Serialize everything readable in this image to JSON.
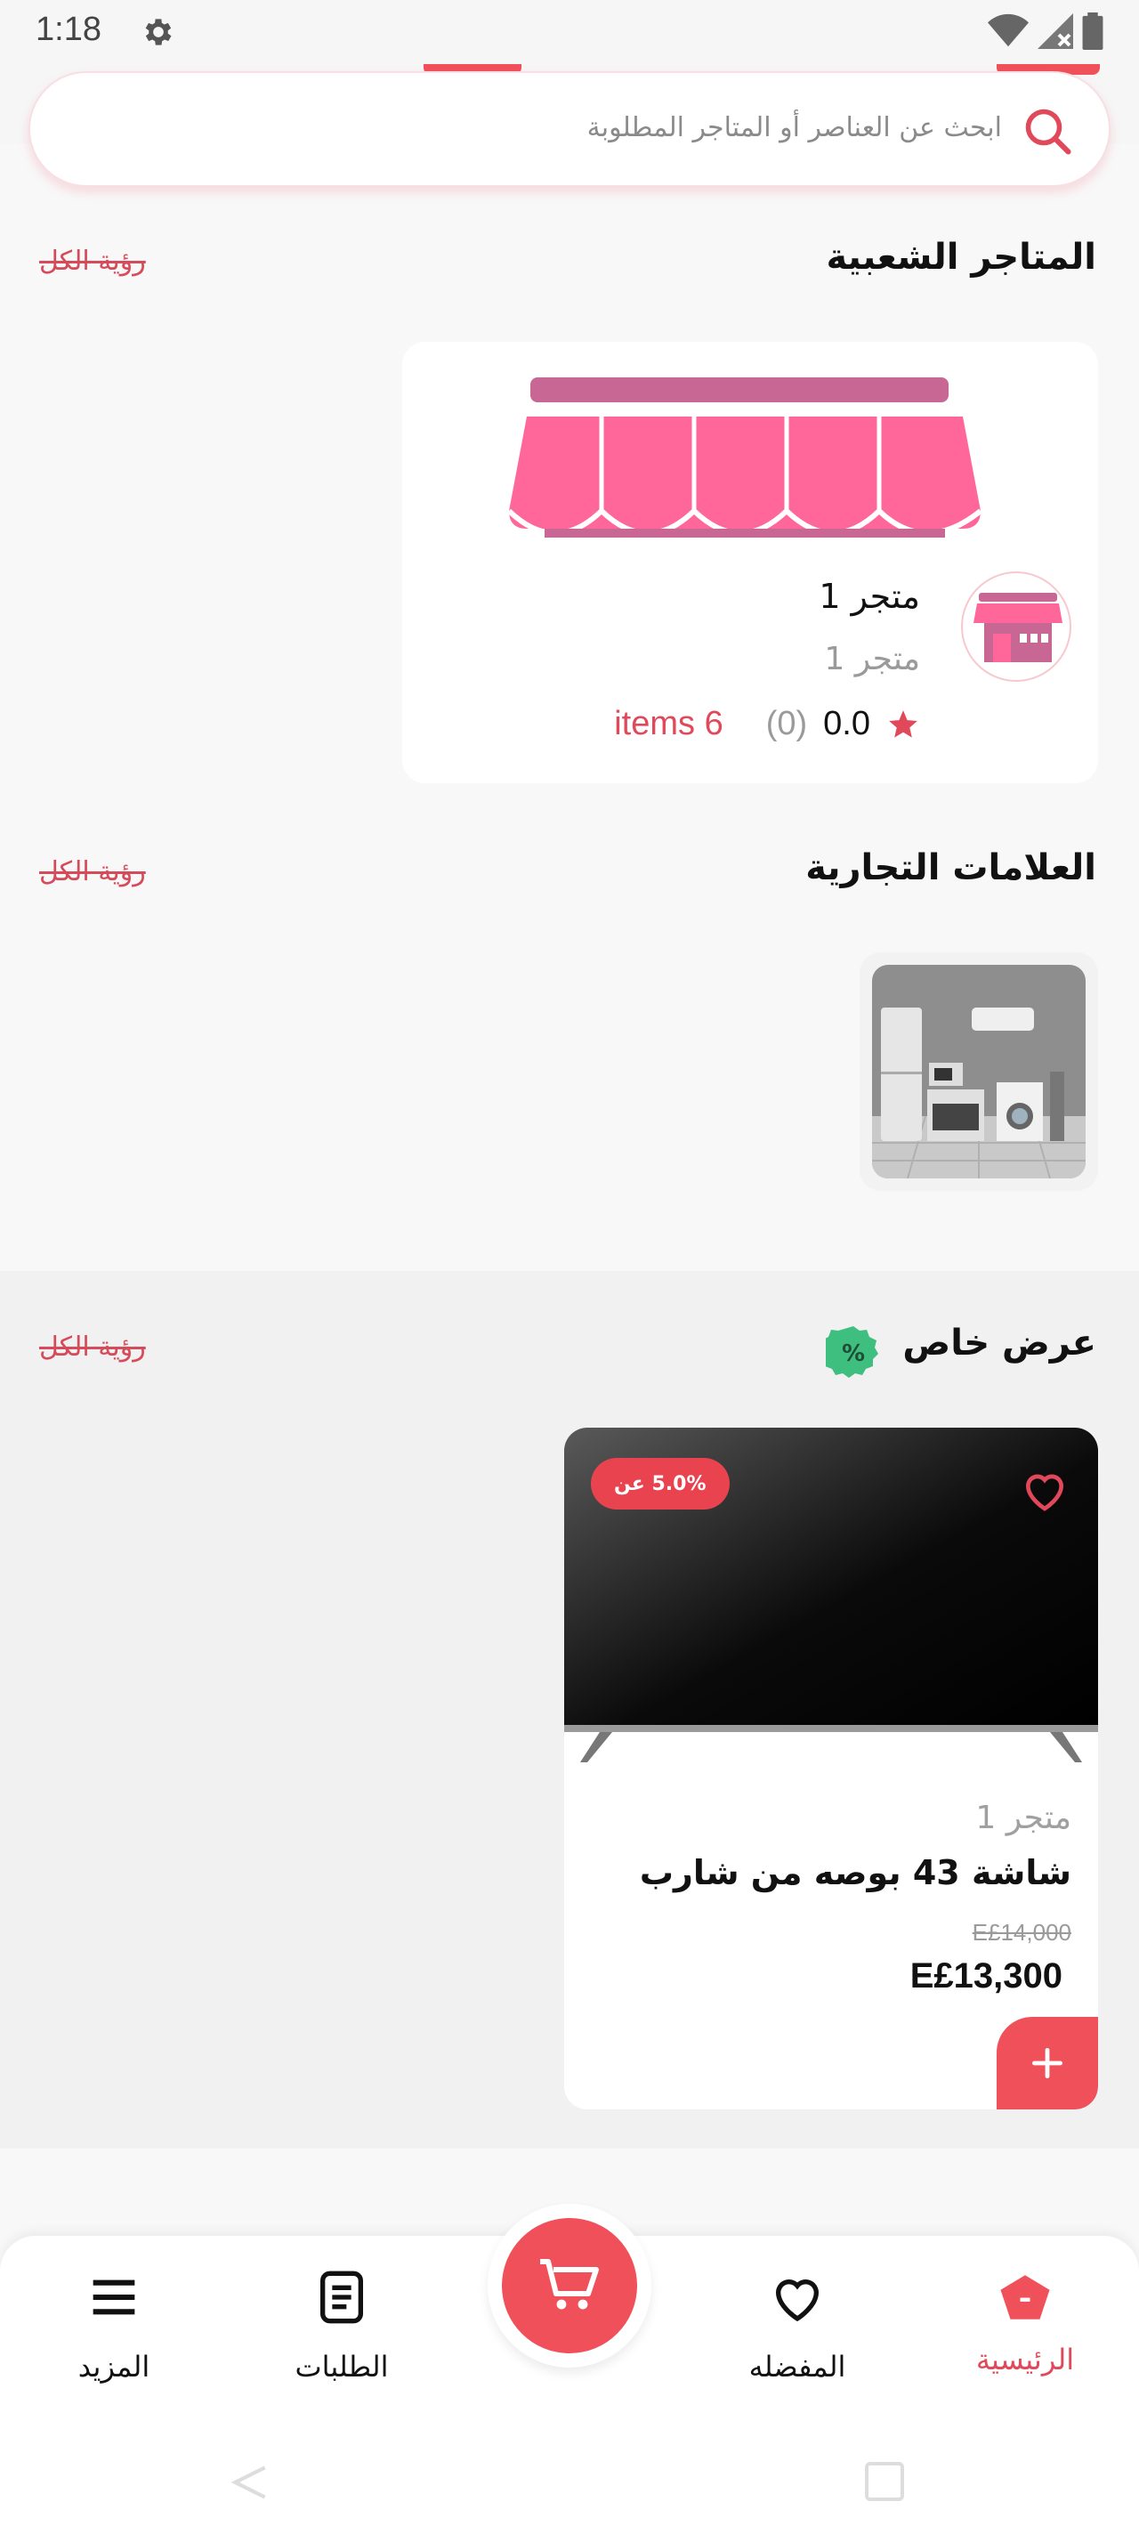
{
  "status_bar": {
    "time": "1:18"
  },
  "search": {
    "placeholder": "ابحث عن العناصر أو المتاجر المطلوبة"
  },
  "popular_stores": {
    "title": "المتاجر الشعبية",
    "see_all": "رؤية الكل",
    "stores": [
      {
        "name": "متجر 1",
        "subtitle": "متجر 1",
        "rating": "0.0",
        "reviews": "(0)",
        "items": "items 6"
      }
    ]
  },
  "brands": {
    "title": "العلامات التجارية",
    "see_all": "رؤية الكل"
  },
  "special_offer": {
    "title": "عرض خاص",
    "see_all": "رؤية الكل",
    "products": [
      {
        "discount": "5.0% عن",
        "store": "متجر 1",
        "name": "شاشة 43 بوصه من شارب",
        "old_price": "E£14,000",
        "price": "E£13,300"
      }
    ]
  },
  "bottom_nav": {
    "items": [
      {
        "label": "الرئيسية",
        "active": true
      },
      {
        "label": "المفضله",
        "active": false
      },
      {
        "label": "الطلبات",
        "active": false
      },
      {
        "label": "المزيد",
        "active": false
      }
    ]
  },
  "colors": {
    "accent": "#f0505a",
    "store_pink": "#ff6699",
    "awning_top": "#c96794",
    "offer_badge": "#3fbf7f"
  }
}
